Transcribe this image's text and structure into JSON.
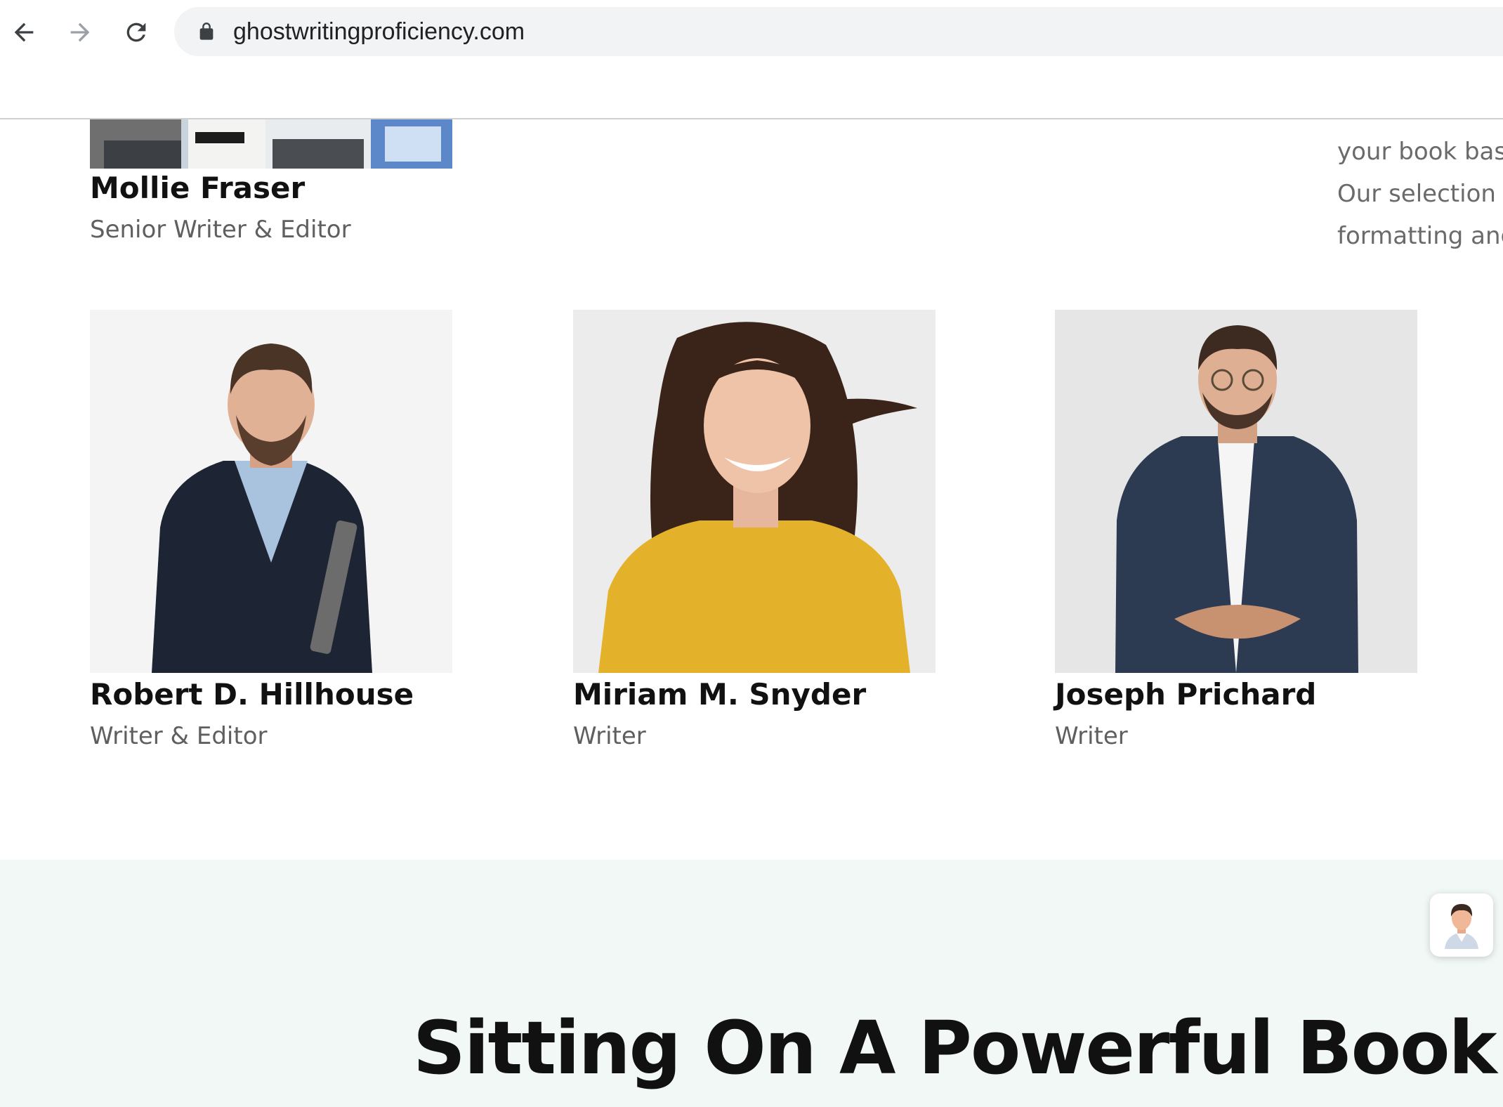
{
  "browser": {
    "url": "ghostwritingproficiency.com",
    "icons": {
      "back": "arrow-left-icon",
      "forward": "arrow-right-icon",
      "reload": "reload-icon",
      "secure": "lock-icon"
    }
  },
  "team": {
    "top_member": {
      "name": "Mollie Fraser",
      "role": "Senior Writer & Editor"
    },
    "members": [
      {
        "name": "Robert D. Hillhouse",
        "role": "Writer & Editor"
      },
      {
        "name": "Miriam M. Snyder",
        "role": "Writer"
      },
      {
        "name": "Joseph Prichard",
        "role": "Writer"
      }
    ]
  },
  "side_text": {
    "lines": [
      "your book base",
      "Our selection e",
      "formatting and"
    ]
  },
  "cta": {
    "heading": "Sitting On A Powerful Book Ide"
  },
  "colors": {
    "cta_background": "#f1f8f6",
    "heading": "#111111",
    "role_text": "#5f5f5f"
  }
}
